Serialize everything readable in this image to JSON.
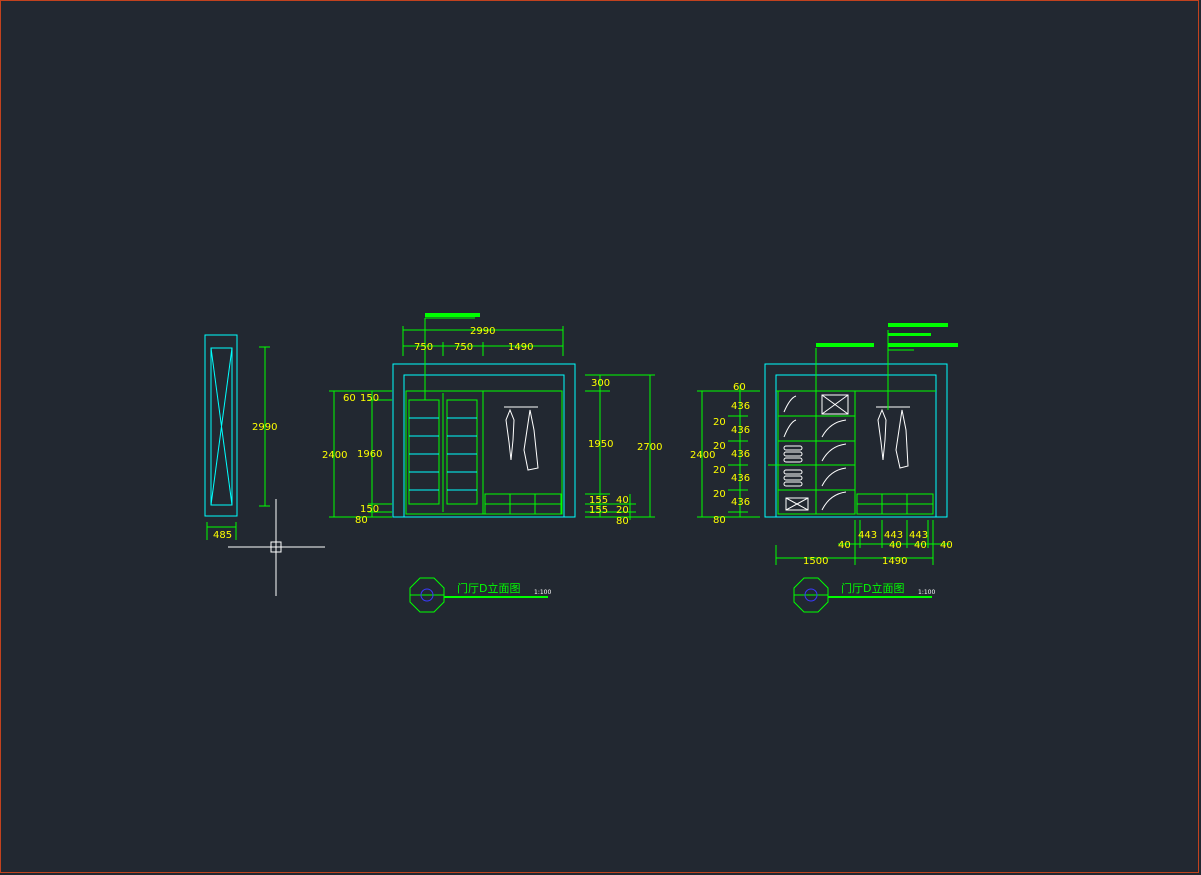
{
  "colors": {
    "background": "#222831",
    "frame": "#c2421e",
    "line_green": "#00ff00",
    "line_cyan": "#00ffff",
    "text_yellow": "#ffff00",
    "crosshair": "#ffffff",
    "door_panel": "#6b6b6b",
    "hatch": "#6f7b86"
  },
  "icons": {
    "section_marker": "octagon-section-marker-icon",
    "crosshair": "cad-crosshair-cursor-icon"
  },
  "side_view": {
    "height_dim": "2990",
    "width_dim": "485"
  },
  "front_elevation": {
    "top_total": "2990",
    "top_parts": [
      "750",
      "750",
      "1490"
    ],
    "left_dims": [
      "60",
      "150",
      "1960",
      "150",
      "80"
    ],
    "left_total": "2400",
    "right_dims": [
      "300",
      "1950",
      "155",
      "155"
    ],
    "right_small": [
      "40",
      "20",
      "80"
    ],
    "right_total": "2700",
    "title": "门厅D立面图",
    "scale": "1:100"
  },
  "section_elevation": {
    "left_dims": [
      "60",
      "436",
      "20",
      "436",
      "20",
      "436",
      "20",
      "436",
      "20",
      "436",
      "80"
    ],
    "left_total": "2400",
    "bottom_top_row": [
      "443",
      "443",
      "443"
    ],
    "bottom_gaps": [
      "40",
      "40",
      "40",
      "40"
    ],
    "bottom_row": [
      "1500",
      "1490"
    ],
    "title": "门厅D立面图",
    "scale": "1:100"
  }
}
